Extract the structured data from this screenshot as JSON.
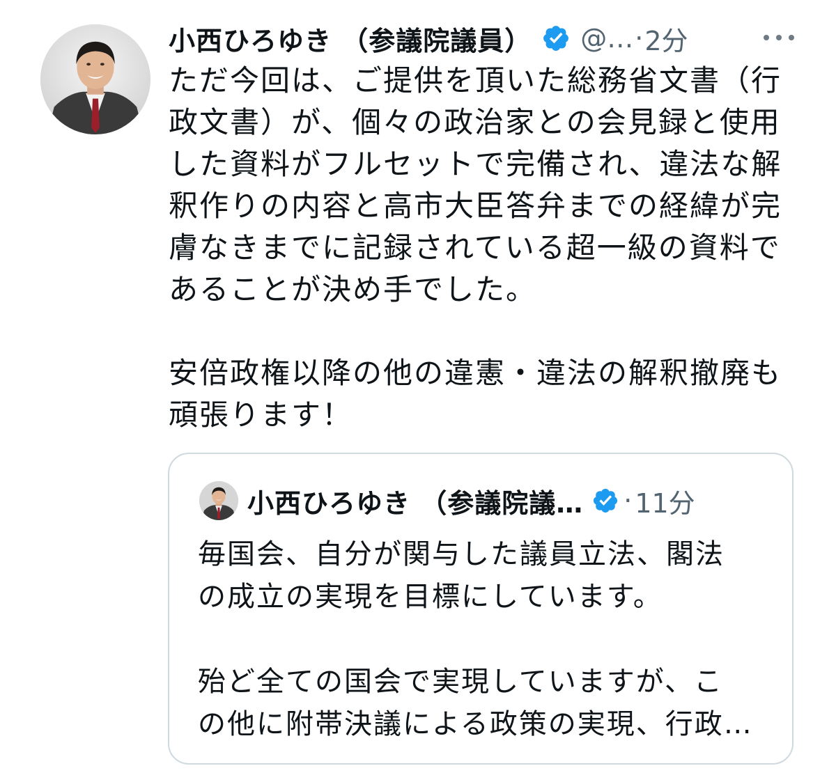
{
  "tweet": {
    "author_name": "小西ひろゆき （参議院議員）",
    "author_handle": "@…",
    "separator": "·",
    "time": "2分",
    "avatar_icon": "profile-photo",
    "verified_icon": "verified-badge-icon",
    "more_icon": "more-options-icon",
    "body_lines": [
      "ただ今回は、ご提供を頂いた総務省文書（行",
      "政文書）が、個々の政治家との会見録と使用",
      "した資料がフルセットで完備され、違法な解",
      "釈作りの内容と高市大臣答弁までの経緯が完",
      "膚なきまでに記録されている超一級の資料で",
      "あることが決め手でした。",
      "",
      "安倍政権以降の他の違憲・違法の解釈撤廃も",
      "頑張ります！"
    ]
  },
  "quoted_tweet": {
    "author_name": "小西ひろゆき （参議院議…",
    "separator": "·",
    "time": "11分",
    "avatar_icon": "profile-photo",
    "verified_icon": "verified-badge-icon",
    "body_lines": [
      "毎国会、自分が関与した議員立法、閣法",
      "の成立の実現を目標にしています。",
      "",
      "殆ど全ての国会で実現していますが、こ",
      "の他に附帯決議による政策の実現、行政…"
    ]
  },
  "colors": {
    "text": "#0f1419",
    "secondary": "#536471",
    "verified": "#1d9bf0",
    "border": "#cfd9de"
  }
}
